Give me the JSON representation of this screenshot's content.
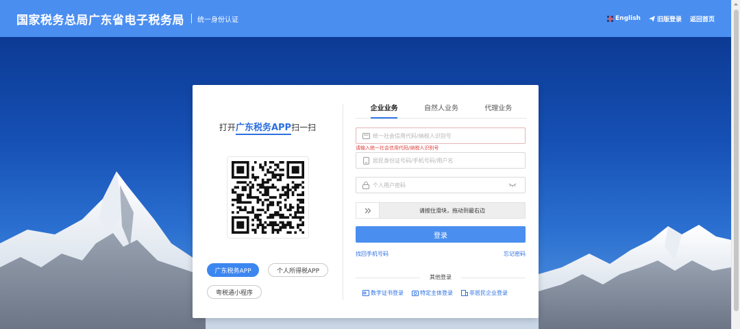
{
  "header": {
    "title": "国家税务总局广东省电子税务局",
    "subtitle": "统一身份认证",
    "links": [
      {
        "label": "English",
        "icon": "flag-icon"
      },
      {
        "label": "旧版登录",
        "icon": "plane-icon"
      },
      {
        "label": "返回首页",
        "icon": ""
      }
    ]
  },
  "left": {
    "scan_prefix": "打开",
    "scan_app": "广东税务APP",
    "scan_suffix": "扫一扫",
    "apps": [
      {
        "label": "广东税务APP",
        "active": true
      },
      {
        "label": "个人所得税APP",
        "active": false
      },
      {
        "label": "粤税通小程序",
        "active": false
      }
    ]
  },
  "login": {
    "tabs": [
      {
        "label": "企业业务",
        "active": true
      },
      {
        "label": "自然人业务",
        "active": false
      },
      {
        "label": "代理业务",
        "active": false
      }
    ],
    "credit_code_placeholder": "统一社会信用代码/纳税人识别号",
    "credit_code_error": "请输入统一社会信用代码/纳税人识别号",
    "account_placeholder": "居民身份证号码/手机号码/用户名",
    "password_placeholder": "个人用户密码",
    "slider_text": "请按住滑块，拖动到最右边",
    "submit_label": "登录",
    "recover_phone": "找回手机号码",
    "forgot_password": "忘记密码",
    "other_title": "其他登录",
    "other_methods": [
      {
        "label": "数字证书登录",
        "icon": "certificate-icon"
      },
      {
        "label": "特定主体登录",
        "icon": "camera-icon"
      },
      {
        "label": "非居民企业登录",
        "icon": "enterprise-icon"
      }
    ]
  },
  "colors": {
    "header_bg": "#4a8ef0",
    "accent": "#2c6fe0",
    "button": "#4a8ef0",
    "error": "#e03c3c"
  }
}
